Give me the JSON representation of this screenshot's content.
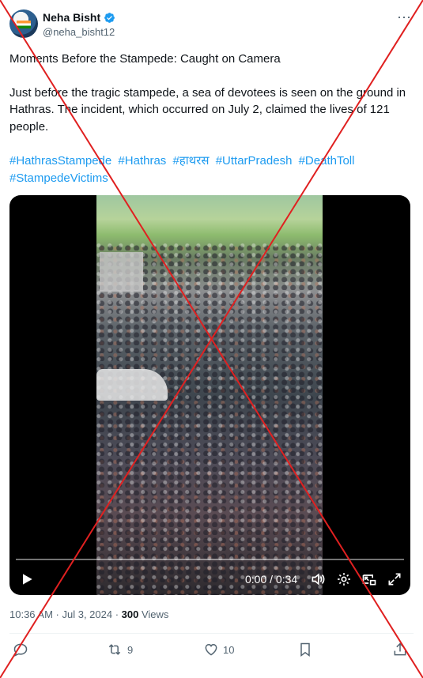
{
  "author": {
    "name": "Neha Bisht",
    "handle": "@neha_bisht12"
  },
  "tweet": {
    "paragraphs": [
      "Moments Before the Stampede: Caught on Camera",
      "Just before the tragic stampede, a sea of devotees is seen on the ground in Hathras. The incident, which occurred on July 2, claimed the lives of 121 people."
    ],
    "hashtags": [
      "#HathrasStampede",
      "#Hathras",
      "#हाथरस",
      "#UttarPradesh",
      "#DeathToll",
      "#StampedeVictims"
    ]
  },
  "video": {
    "time": "0:00 / 0:34",
    "progress": 0.0
  },
  "meta": {
    "timestamp": "10:36 AM · Jul 3, 2024 · ",
    "views_count": "300",
    "views_label": " Views"
  },
  "actions": {
    "reply_count": "",
    "retweet_count": "9",
    "like_count": "10"
  },
  "colors": {
    "accent": "#1d9bf0",
    "overlay_cross": "#e02020",
    "muted": "#536471"
  },
  "icons": [
    "verified-badge-icon",
    "more-icon",
    "play-icon",
    "volume-icon",
    "settings-icon",
    "pip-icon",
    "fullscreen-icon",
    "reply-icon",
    "retweet-icon",
    "like-icon",
    "bookmark-icon",
    "share-icon"
  ]
}
